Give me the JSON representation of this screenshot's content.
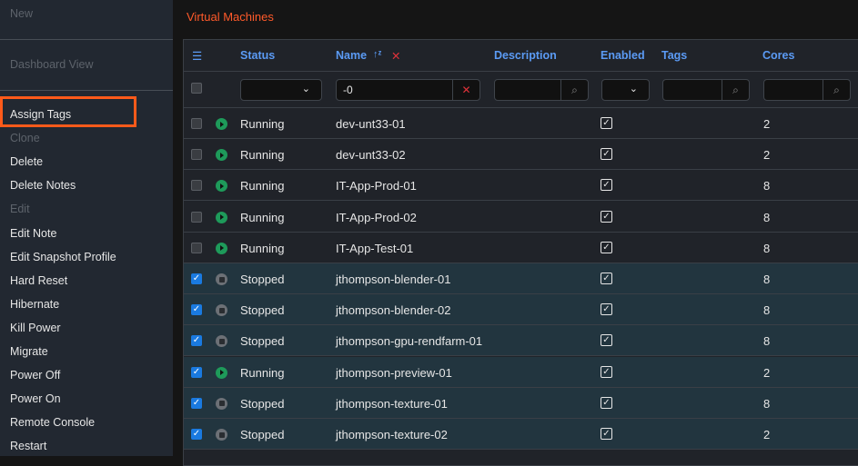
{
  "sidebar": {
    "top": [
      "New",
      "Dashboard View"
    ],
    "items": [
      {
        "label": "Assign Tags",
        "disabled": false
      },
      {
        "label": "Clone",
        "disabled": true
      },
      {
        "label": "Delete",
        "disabled": false
      },
      {
        "label": "Delete Notes",
        "disabled": false
      },
      {
        "label": "Edit",
        "disabled": true
      },
      {
        "label": "Edit Note",
        "disabled": false
      },
      {
        "label": "Edit Snapshot Profile",
        "disabled": false
      },
      {
        "label": "Hard Reset",
        "disabled": false
      },
      {
        "label": "Hibernate",
        "disabled": false
      },
      {
        "label": "Kill Power",
        "disabled": false
      },
      {
        "label": "Migrate",
        "disabled": false
      },
      {
        "label": "Power Off",
        "disabled": false
      },
      {
        "label": "Power On",
        "disabled": false
      },
      {
        "label": "Remote Console",
        "disabled": false
      },
      {
        "label": "Restart",
        "disabled": false
      }
    ]
  },
  "title": "Virtual Machines",
  "columns": [
    "Status",
    "Name",
    "Description",
    "Enabled",
    "Tags",
    "Cores"
  ],
  "filters": {
    "name": "-0"
  },
  "rows": [
    {
      "selected": false,
      "status": "Running",
      "name": "dev-unt33-01",
      "enabled": true,
      "cores": "2"
    },
    {
      "selected": false,
      "status": "Running",
      "name": "dev-unt33-02",
      "enabled": true,
      "cores": "2"
    },
    {
      "selected": false,
      "status": "Running",
      "name": "IT-App-Prod-01",
      "enabled": true,
      "cores": "8"
    },
    {
      "selected": false,
      "status": "Running",
      "name": "IT-App-Prod-02",
      "enabled": true,
      "cores": "8"
    },
    {
      "selected": false,
      "status": "Running",
      "name": "IT-App-Test-01",
      "enabled": true,
      "cores": "8"
    },
    {
      "selected": true,
      "status": "Stopped",
      "name": "jthompson-blender-01",
      "enabled": true,
      "cores": "8"
    },
    {
      "selected": true,
      "status": "Stopped",
      "name": "jthompson-blender-02",
      "enabled": true,
      "cores": "8"
    },
    {
      "selected": true,
      "status": "Stopped",
      "name": "jthompson-gpu-rendfarm-01",
      "enabled": true,
      "cores": "8"
    },
    {
      "selected": true,
      "status": "Running",
      "name": "jthompson-preview-01",
      "enabled": true,
      "cores": "2"
    },
    {
      "selected": true,
      "status": "Stopped",
      "name": "jthompson-texture-01",
      "enabled": true,
      "cores": "8"
    },
    {
      "selected": true,
      "status": "Stopped",
      "name": "jthompson-texture-02",
      "enabled": true,
      "cores": "2"
    }
  ],
  "colors": {
    "accent": "#ff5a1a",
    "header": "#5b9bf5",
    "running": "#1e9a5a",
    "stopped": "#6c7076"
  }
}
